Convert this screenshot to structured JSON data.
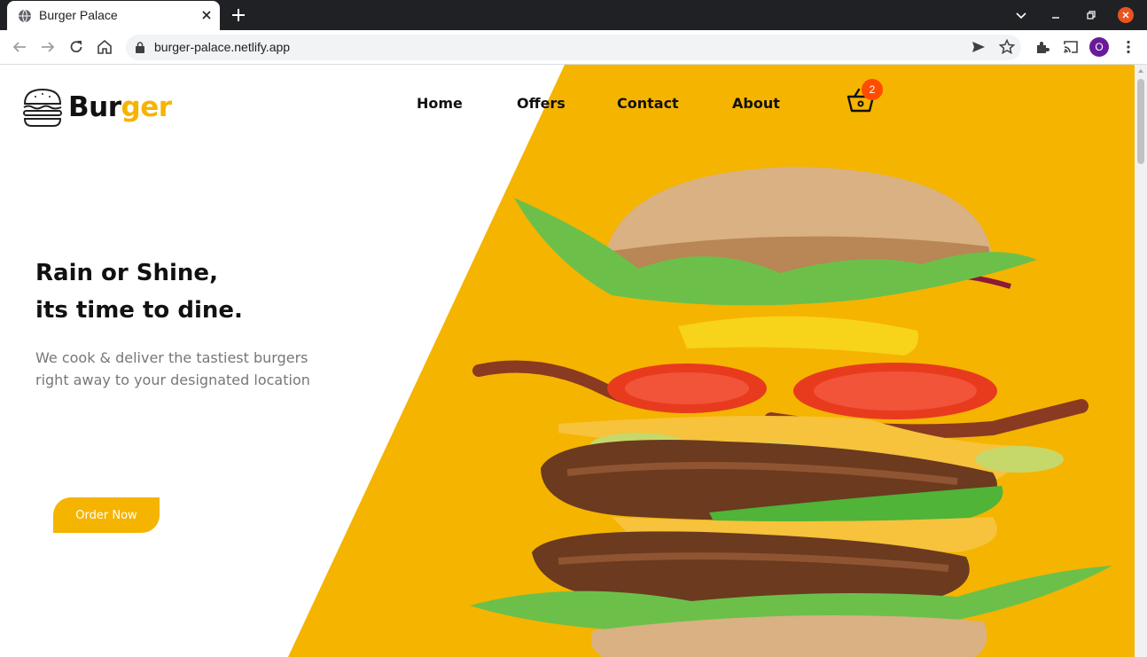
{
  "browser": {
    "tab_title": "Burger Palace",
    "url": "burger-palace.netlify.app",
    "profile_initial": "O"
  },
  "site": {
    "logo": {
      "part1": "Bur",
      "part2": "ger"
    },
    "nav": [
      "Home",
      "Offers",
      "Contact",
      "About"
    ],
    "cart_count": "2"
  },
  "hero": {
    "headline_line1": "Rain or Shine,",
    "headline_line2": "its time to dine.",
    "subtext_line1": "We cook & deliver the tastiest burgers",
    "subtext_line2": "right away to your designated location",
    "cta": "Order Now"
  },
  "colors": {
    "accent": "#f5b400",
    "badge": "#ff4d00",
    "chrome_dark": "#202124"
  }
}
